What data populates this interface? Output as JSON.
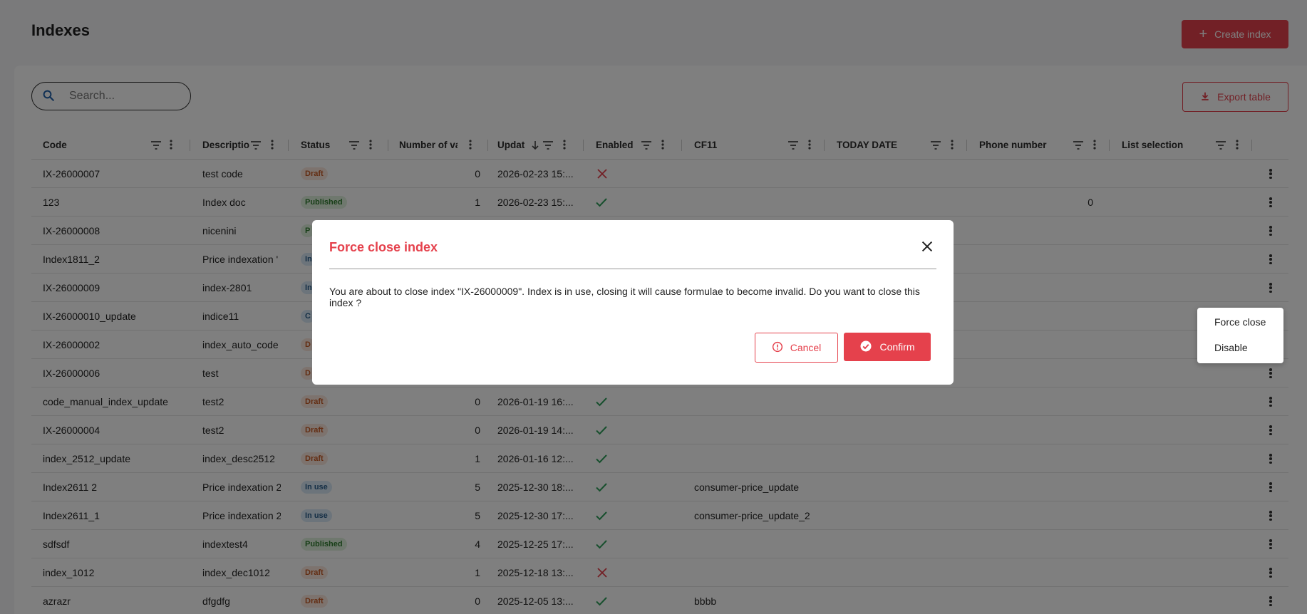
{
  "page": {
    "title": "Indexes"
  },
  "toolbar": {
    "create_label": "Create index",
    "export_label": "Export table"
  },
  "search": {
    "placeholder": "Search...",
    "value": ""
  },
  "table": {
    "columns": [
      "Code",
      "Descriptio",
      "Status",
      "Number of va",
      "Updat",
      "Enabled",
      "CF11",
      "TODAY DATE",
      "Phone number",
      "List selection"
    ],
    "sort": {
      "column": "Updat",
      "direction": "descending"
    },
    "rows": [
      {
        "code": "IX-26000007",
        "description": "test code",
        "status": "Draft",
        "count": "0",
        "updated": "2026-02-23 15:...",
        "enabled": false,
        "cf11": "",
        "phone": ""
      },
      {
        "code": "123",
        "description": "Index doc",
        "status": "Published",
        "count": "1",
        "updated": "2026-02-23 15:...",
        "enabled": true,
        "cf11": "",
        "phone": "0"
      },
      {
        "code": "IX-26000008",
        "description": "nicenini",
        "status": "P",
        "count": "",
        "updated": "",
        "enabled": null,
        "cf11": "",
        "phone": ""
      },
      {
        "code": "Index1811_2",
        "description": "Price indexation '",
        "status": "In",
        "count": "",
        "updated": "",
        "enabled": null,
        "cf11": "",
        "phone": ""
      },
      {
        "code": "IX-26000009",
        "description": "index-2801",
        "status": "In",
        "count": "",
        "updated": "",
        "enabled": null,
        "cf11": "",
        "phone": ""
      },
      {
        "code": "IX-26000010_update",
        "description": "indice11",
        "status": "C",
        "count": "",
        "updated": "",
        "enabled": null,
        "cf11": "",
        "phone": ""
      },
      {
        "code": "IX-26000002",
        "description": "index_auto_code",
        "status": "D",
        "count": "",
        "updated": "",
        "enabled": null,
        "cf11": "",
        "phone": ""
      },
      {
        "code": "IX-26000006",
        "description": "test",
        "status": "D",
        "count": "",
        "updated": "",
        "enabled": null,
        "cf11": "",
        "phone": ""
      },
      {
        "code": "code_manual_index_update",
        "description": "test2",
        "status": "Draft",
        "count": "0",
        "updated": "2026-01-19 16:...",
        "enabled": true,
        "cf11": "",
        "phone": ""
      },
      {
        "code": "IX-26000004",
        "description": "test2",
        "status": "Draft",
        "count": "0",
        "updated": "2026-01-19 14:...",
        "enabled": true,
        "cf11": "",
        "phone": ""
      },
      {
        "code": "index_2512_update",
        "description": "index_desc2512",
        "status": "Draft",
        "count": "1",
        "updated": "2026-01-16 12:...",
        "enabled": true,
        "cf11": "",
        "phone": ""
      },
      {
        "code": "Index2611 2",
        "description": "Price indexation 2",
        "status": "In use",
        "count": "5",
        "updated": "2025-12-30 18:...",
        "enabled": true,
        "cf11": "consumer-price_update",
        "phone": ""
      },
      {
        "code": "Index2611_1",
        "description": "Price indexation 2",
        "status": "In use",
        "count": "5",
        "updated": "2025-12-30 17:...",
        "enabled": true,
        "cf11": "consumer-price_update_2",
        "phone": ""
      },
      {
        "code": "sdfsdf",
        "description": "indextest4",
        "status": "Published",
        "count": "4",
        "updated": "2025-12-25 17:...",
        "enabled": true,
        "cf11": "",
        "phone": ""
      },
      {
        "code": "index_1012",
        "description": "index_dec1012",
        "status": "Draft",
        "count": "1",
        "updated": "2025-12-18 13:...",
        "enabled": false,
        "cf11": "",
        "phone": ""
      },
      {
        "code": "azrazr",
        "description": "dfgdfg",
        "status": "Draft",
        "count": "0",
        "updated": "2025-12-05 13:...",
        "enabled": true,
        "cf11": "bbbb",
        "phone": ""
      }
    ]
  },
  "context_menu": {
    "items": [
      "Force close",
      "Disable"
    ]
  },
  "modal": {
    "title": "Force close index",
    "message": "You are about to close index \"IX-26000009\". Index is in use, closing it will cause formulae to become invalid. Do you want to close this index ?",
    "cancel_label": "Cancel",
    "confirm_label": "Confirm"
  },
  "icons": {
    "search": "search-icon",
    "plus": "plus-icon",
    "download": "download-icon",
    "filter": "filter-icon",
    "more": "more-vert-icon",
    "check": "check-icon",
    "cross": "cross-icon",
    "close": "close-icon",
    "alert": "alert-circle-icon",
    "confirm": "check-circle-icon",
    "sort": "arrow-down-icon"
  },
  "colors": {
    "accent": "#e5414c",
    "check": "#2e9e5b",
    "draft_bg": "#fbe6dc",
    "published_bg": "#dff1dc",
    "inuse_bg": "#d8e8f6"
  }
}
